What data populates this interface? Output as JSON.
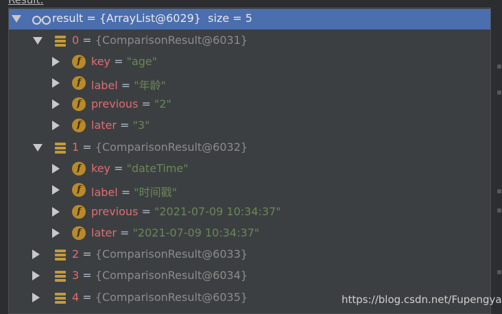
{
  "header": {
    "label": "Result:"
  },
  "tree": {
    "root": {
      "name": "result",
      "eq": " = ",
      "value": "{ArrayList@6029}",
      "size": "size = 5"
    },
    "item0": {
      "name": "0",
      "eq": " = ",
      "value": "{ComparisonResult@6031}"
    },
    "item0_key": {
      "name": "key",
      "eq": " = ",
      "value": "\"age\""
    },
    "item0_label": {
      "name": "label",
      "eq": " = ",
      "value": "\"年龄\""
    },
    "item0_previous": {
      "name": "previous",
      "eq": " = ",
      "value": "\"2\""
    },
    "item0_later": {
      "name": "later",
      "eq": " = ",
      "value": "\"3\""
    },
    "item1": {
      "name": "1",
      "eq": " = ",
      "value": "{ComparisonResult@6032}"
    },
    "item1_key": {
      "name": "key",
      "eq": " = ",
      "value": "\"dateTime\""
    },
    "item1_label": {
      "name": "label",
      "eq": " = ",
      "value": "\"时间戳\""
    },
    "item1_previous": {
      "name": "previous",
      "eq": " = ",
      "value": "\"2021-07-09 10:34:37\""
    },
    "item1_later": {
      "name": "later",
      "eq": " = ",
      "value": "\"2021-07-09 10:34:37\""
    },
    "item2": {
      "name": "2",
      "eq": " = ",
      "value": "{ComparisonResult@6033}"
    },
    "item3": {
      "name": "3",
      "eq": " = ",
      "value": "{ComparisonResult@6034}"
    },
    "item4": {
      "name": "4",
      "eq": " = ",
      "value": "{ComparisonResult@6035}"
    }
  },
  "icons": {
    "watch": "watch-glasses-icon",
    "list_item": "list-item-icon",
    "field": "field-icon",
    "expanded": "chevron-down-icon",
    "collapsed": "chevron-right-icon"
  },
  "colors": {
    "selection": "#4b6eaf",
    "field_name": "#e06c75",
    "string_value": "#6a8759",
    "field_icon": "#b88a2a",
    "list_icon": "#c49a3a"
  },
  "watermark": "https://blog.csdn.net/Fupengyao"
}
